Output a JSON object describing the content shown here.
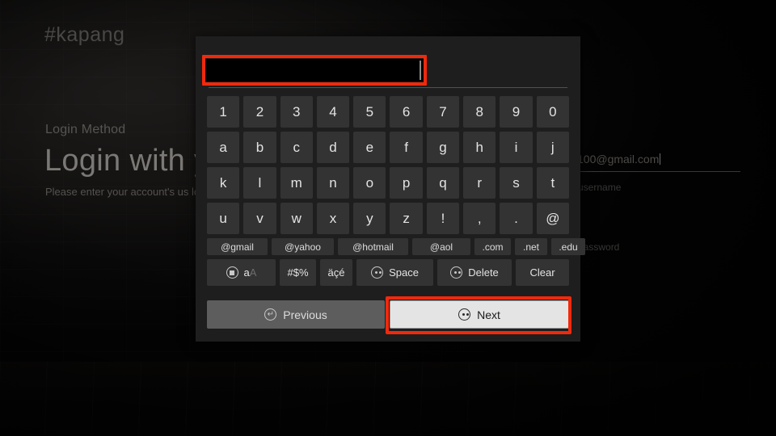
{
  "background": {
    "logo": "#kapang",
    "eyebrow": "Login Method",
    "title": "Login with y",
    "subtitle": "Please enter your account's us login.",
    "field_value": "100@gmail.com",
    "label_username": "username",
    "label_password": "password"
  },
  "keyboard": {
    "input": {
      "value": "",
      "redacted": true
    },
    "rows": [
      [
        "1",
        "2",
        "3",
        "4",
        "5",
        "6",
        "7",
        "8",
        "9",
        "0"
      ],
      [
        "a",
        "b",
        "c",
        "d",
        "e",
        "f",
        "g",
        "h",
        "i",
        "j"
      ],
      [
        "k",
        "l",
        "m",
        "n",
        "o",
        "p",
        "q",
        "r",
        "s",
        "t"
      ],
      [
        "u",
        "v",
        "w",
        "x",
        "y",
        "z",
        "!",
        ",",
        ".",
        "@"
      ]
    ],
    "domains": [
      "@gmail",
      "@yahoo",
      "@hotmail",
      "@aol",
      ".com",
      ".net",
      ".edu"
    ],
    "functions": {
      "case_lower": "a",
      "case_upper": "A",
      "symbols": "#$%",
      "accents": "äçé",
      "space": "Space",
      "delete": "Delete",
      "clear": "Clear"
    },
    "nav": {
      "previous": "Previous",
      "next": "Next"
    },
    "icons": {
      "case_icon": "stop-circle-icon",
      "space_icon": "fast-forward-circle-icon",
      "delete_icon": "rewind-circle-icon",
      "previous_icon": "back-arrow-circle-icon",
      "next_icon": "play-pause-circle-icon"
    }
  },
  "annotations": {
    "highlight_color": "#f0290d",
    "boxes": [
      "input-field-redaction",
      "next-button-highlight"
    ]
  }
}
